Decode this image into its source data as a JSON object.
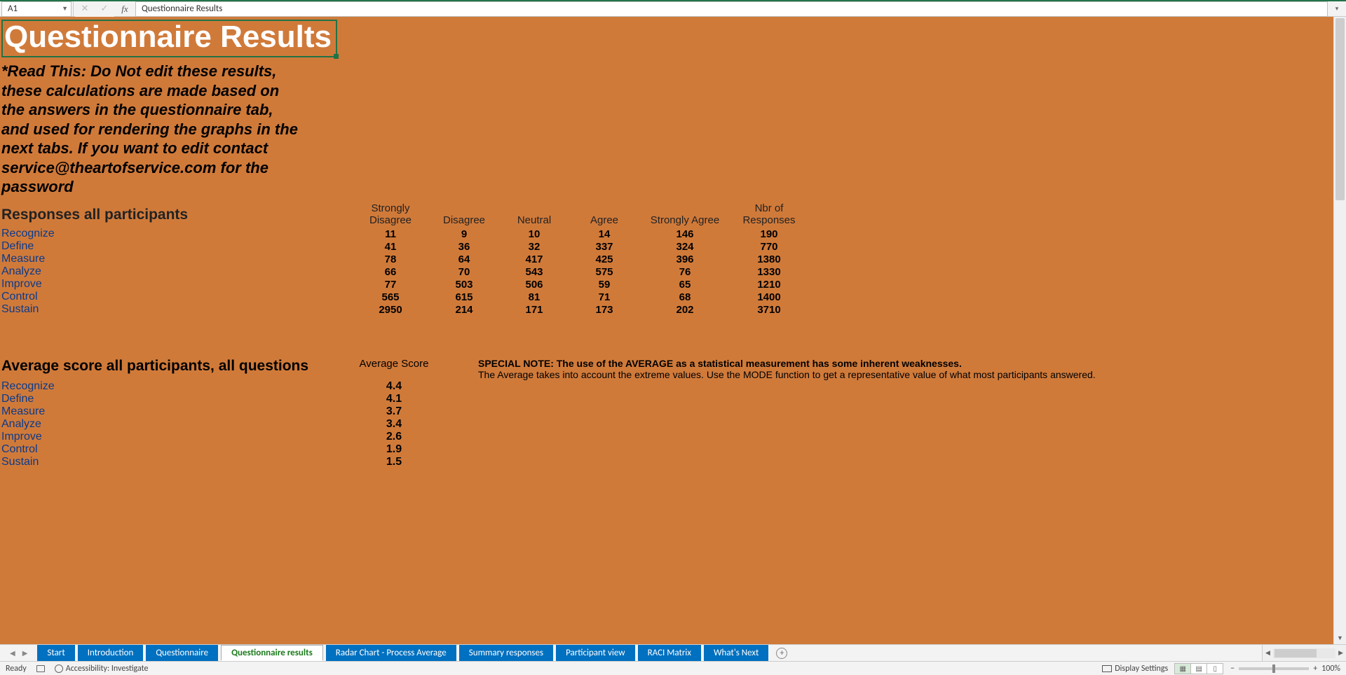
{
  "formula_bar": {
    "cell_ref": "A1",
    "content": "Questionnaire Results"
  },
  "sheet": {
    "title": "Questionnaire Results",
    "warning": "*Read This: Do Not edit these results, these calculations are made based on the answers in the questionnaire tab, and used for rendering the graphs in the next tabs. If you want to edit contact service@theartofservice.com for the password",
    "section1": {
      "heading": "Responses all participants",
      "columns": [
        "Strongly Disagree",
        "Disagree",
        "Neutral",
        "Agree",
        "Strongly Agree",
        "Nbr of Responses"
      ],
      "rows": [
        {
          "cat": "Recognize",
          "vals": [
            "11",
            "9",
            "10",
            "14",
            "146",
            "190"
          ]
        },
        {
          "cat": "Define",
          "vals": [
            "41",
            "36",
            "32",
            "337",
            "324",
            "770"
          ]
        },
        {
          "cat": "Measure",
          "vals": [
            "78",
            "64",
            "417",
            "425",
            "396",
            "1380"
          ]
        },
        {
          "cat": "Analyze",
          "vals": [
            "66",
            "70",
            "543",
            "575",
            "76",
            "1330"
          ]
        },
        {
          "cat": "Improve",
          "vals": [
            "77",
            "503",
            "506",
            "59",
            "65",
            "1210"
          ]
        },
        {
          "cat": "Control",
          "vals": [
            "565",
            "615",
            "81",
            "71",
            "68",
            "1400"
          ]
        },
        {
          "cat": "Sustain",
          "vals": [
            "2950",
            "214",
            "171",
            "173",
            "202",
            "3710"
          ]
        }
      ]
    },
    "section2": {
      "heading": "Average score all participants, all questions",
      "col": "Average Score",
      "note_bold": "SPECIAL NOTE: The use of the AVERAGE as a statistical measurement has some inherent weaknesses.",
      "note": "The Average takes into account the extreme values. Use the MODE function to get a representative value of what most participants answered.",
      "rows": [
        {
          "cat": "Recognize",
          "val": "4.4"
        },
        {
          "cat": "Define",
          "val": "4.1"
        },
        {
          "cat": "Measure",
          "val": "3.7"
        },
        {
          "cat": "Analyze",
          "val": "3.4"
        },
        {
          "cat": "Improve",
          "val": "2.6"
        },
        {
          "cat": "Control",
          "val": "1.9"
        },
        {
          "cat": "Sustain",
          "val": "1.5"
        }
      ]
    }
  },
  "tabs": {
    "items": [
      "Start",
      "Introduction",
      "Questionnaire",
      "Questionnaire results",
      "Radar Chart - Process Average",
      "Summary responses",
      "Participant view",
      "RACI Matrix",
      "What's Next"
    ],
    "active_index": 3
  },
  "status": {
    "ready": "Ready",
    "accessibility": "Accessibility: Investigate",
    "display_settings": "Display Settings",
    "zoom": "100%"
  },
  "chart_data": [
    {
      "type": "table",
      "title": "Responses all participants",
      "categories": [
        "Recognize",
        "Define",
        "Measure",
        "Analyze",
        "Improve",
        "Control",
        "Sustain"
      ],
      "series": [
        {
          "name": "Strongly Disagree",
          "values": [
            11,
            41,
            78,
            66,
            77,
            565,
            2950
          ]
        },
        {
          "name": "Disagree",
          "values": [
            9,
            36,
            64,
            70,
            503,
            615,
            214
          ]
        },
        {
          "name": "Neutral",
          "values": [
            10,
            32,
            417,
            543,
            506,
            81,
            171
          ]
        },
        {
          "name": "Agree",
          "values": [
            14,
            337,
            425,
            575,
            59,
            71,
            173
          ]
        },
        {
          "name": "Strongly Agree",
          "values": [
            146,
            324,
            396,
            76,
            65,
            68,
            202
          ]
        },
        {
          "name": "Nbr of Responses",
          "values": [
            190,
            770,
            1380,
            1330,
            1210,
            1400,
            3710
          ]
        }
      ]
    },
    {
      "type": "table",
      "title": "Average score all participants, all questions",
      "categories": [
        "Recognize",
        "Define",
        "Measure",
        "Analyze",
        "Improve",
        "Control",
        "Sustain"
      ],
      "series": [
        {
          "name": "Average Score",
          "values": [
            4.4,
            4.1,
            3.7,
            3.4,
            2.6,
            1.9,
            1.5
          ]
        }
      ]
    }
  ]
}
